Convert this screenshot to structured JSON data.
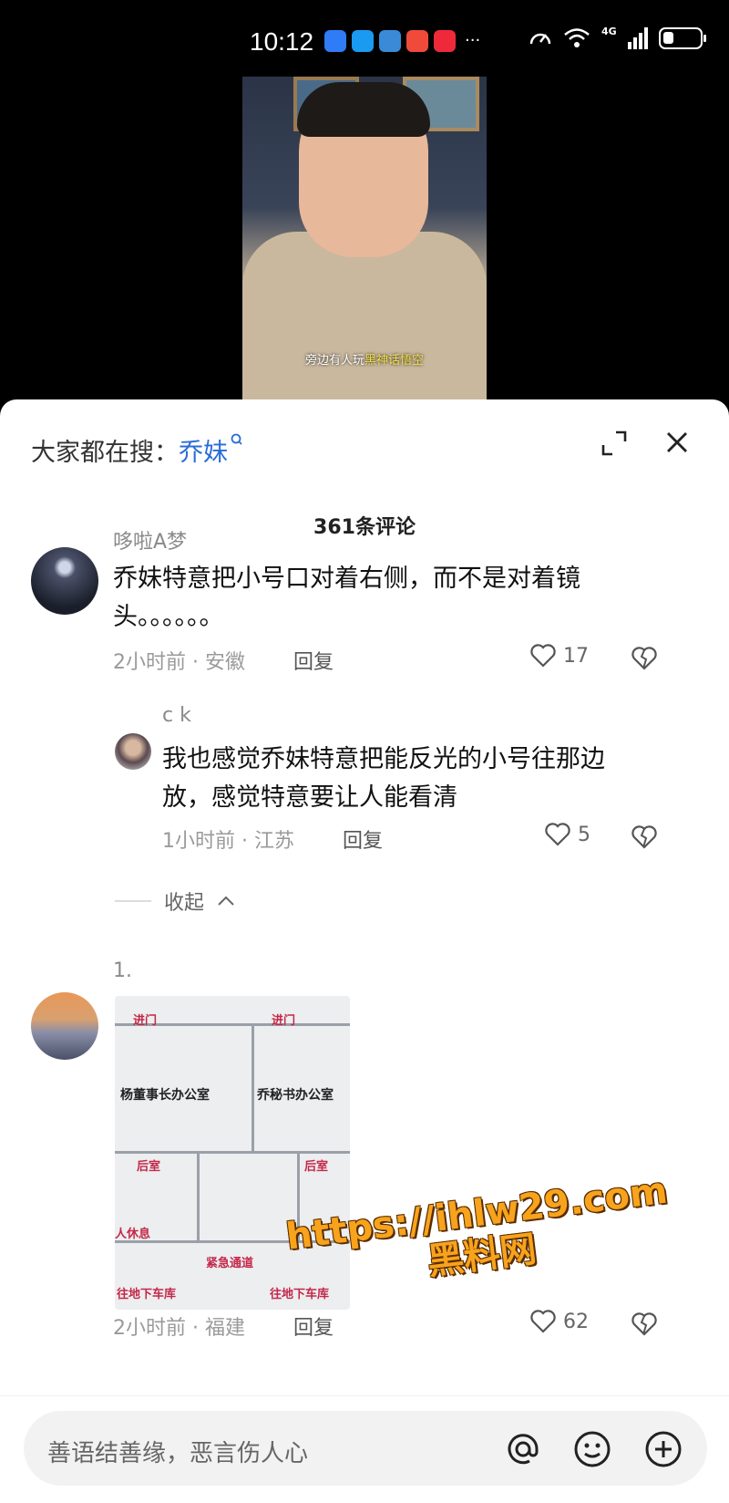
{
  "status_bar": {
    "time": "10:12",
    "more": "···",
    "network": "4G",
    "battery_level": 0.3
  },
  "video": {
    "caption_prefix": "旁边有人玩",
    "caption_highlight": "黑神话悟空"
  },
  "sheet": {
    "search_label": "大家都在搜：",
    "search_term": "乔妹",
    "comment_count": "361条评论"
  },
  "comments": [
    {
      "user": "哆啦A梦",
      "text_line1": "乔妹特意把小号口对着右侧，而不是对着镜",
      "text_line2": "头。。。。。。",
      "meta": "2小时前 · 安徽",
      "reply": "回复",
      "likes": "17"
    },
    {
      "user": "c k",
      "text_line1": "我也感觉乔妹特意把能反光的小号往那边",
      "text_line2": "放，感觉特意要让人能看清",
      "meta": "1小时前 · 江苏",
      "reply": "回复",
      "likes": "5"
    },
    {
      "user": "1.",
      "meta": "2小时前 · 福建",
      "reply": "回复",
      "likes": "62"
    }
  ],
  "collapse_label": "收起",
  "floorplan": {
    "label_left": "杨董事长办公室",
    "label_right": "乔秘书办公室",
    "door1": "进门",
    "door2": "进门",
    "back_room1": "后室",
    "back_room2": "后室",
    "emergency": "紧急通道",
    "exit_left": "往地下车库",
    "exit_right": "往地下车库",
    "rest": "人休息"
  },
  "watermark": {
    "line1": "https://ihlw29.com",
    "line2": "黑料网"
  },
  "input": {
    "placeholder": "善语结善缘，恶言伤人心"
  },
  "colors": {
    "link": "#2a6cd8",
    "watermark": "#f7a31c"
  }
}
